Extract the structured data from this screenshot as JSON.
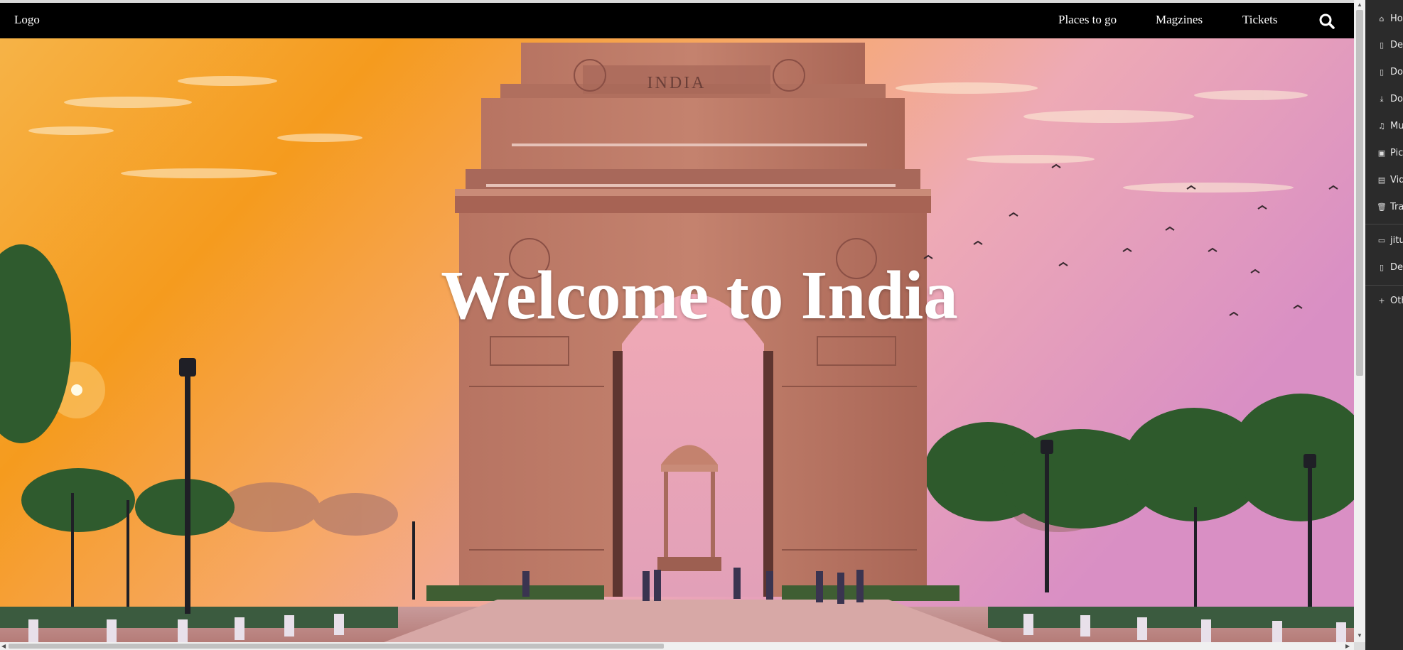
{
  "navbar": {
    "logo": "Logo",
    "links": [
      "Places to go",
      "Magzines",
      "Tickets"
    ],
    "search_icon": "search-icon"
  },
  "hero": {
    "title": "Welcome to India",
    "arch_inscription": "INDIA"
  },
  "side_panel": {
    "items": [
      {
        "icon": "home-icon",
        "label": "Home"
      },
      {
        "icon": "document-icon",
        "label": "Desktop"
      },
      {
        "icon": "document-icon",
        "label": "Documents"
      },
      {
        "icon": "download-icon",
        "label": "Downloads"
      },
      {
        "icon": "music-icon",
        "label": "Music"
      },
      {
        "icon": "picture-icon",
        "label": "Pictures"
      },
      {
        "icon": "video-icon",
        "label": "Videos"
      },
      {
        "icon": "trash-icon",
        "label": "Trash"
      },
      {
        "icon": "folder-icon",
        "label": "jitu"
      },
      {
        "icon": "document-icon",
        "label": "Desktop"
      },
      {
        "icon": "plus-icon",
        "label": "Other Locations"
      }
    ]
  },
  "colors": {
    "navbar_bg": "#000000",
    "sky_orange": "#f5a022",
    "sky_pink": "#e89ab8",
    "sandstone": "#b56a5c",
    "sidebar_bg": "#2b2b2b"
  }
}
